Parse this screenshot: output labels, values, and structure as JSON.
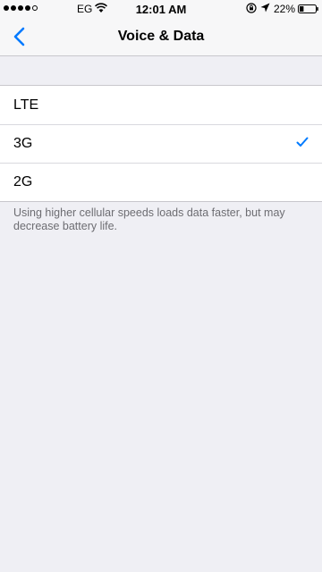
{
  "status_bar": {
    "carrier": "EG",
    "time": "12:01 AM",
    "battery_percent": "22%",
    "signal_bars": 4,
    "signal_max": 5,
    "icons": [
      "wifi-icon",
      "rotation-lock-icon",
      "location-arrow-icon",
      "battery-icon"
    ]
  },
  "nav": {
    "back_icon": "chevron-left-icon",
    "title": "Voice & Data"
  },
  "options": [
    {
      "label": "LTE",
      "selected": false
    },
    {
      "label": "3G",
      "selected": true
    },
    {
      "label": "2G",
      "selected": false
    }
  ],
  "footer_note": "Using higher cellular speeds loads data faster, but may decrease battery life.",
  "colors": {
    "accent": "#007aff",
    "background": "#efeff4",
    "footer_text": "#6d6d72"
  }
}
